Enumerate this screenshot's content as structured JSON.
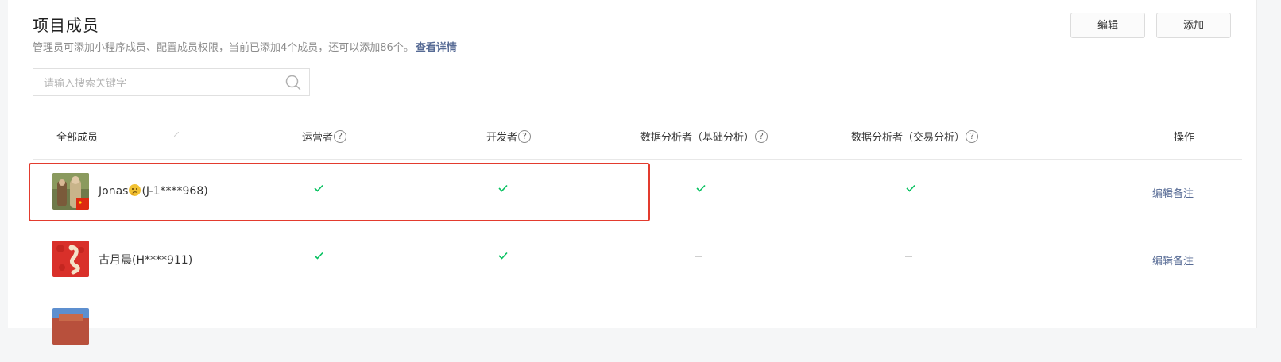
{
  "header": {
    "title": "项目成员",
    "subtitle": "管理员可添加小程序成员、配置成员权限，当前已添加4个成员，还可以添加86个。",
    "detail_link": "查看详情"
  },
  "toolbar": {
    "edit_label": "编辑",
    "add_label": "添加"
  },
  "search": {
    "placeholder": "请输入搜索关键字",
    "value": ""
  },
  "table": {
    "columns": {
      "all_members": "全部成员",
      "operator": "运营者",
      "developer": "开发者",
      "analyst_basic": "数据分析者（基础分析）",
      "analyst_trade": "数据分析者（交易分析）",
      "actions": "操作"
    },
    "rows": [
      {
        "name_prefix": "Jonas",
        "name_suffix": "(J-1****968)",
        "operator": true,
        "developer": true,
        "analyst_basic": true,
        "analyst_trade": true,
        "action": "编辑备注",
        "highlighted": true
      },
      {
        "name": "古月晨(H****911)",
        "operator": true,
        "developer": true,
        "analyst_basic": false,
        "analyst_trade": false,
        "action": "编辑备注",
        "highlighted": false
      }
    ]
  },
  "colors": {
    "link": "#576b95",
    "check": "#07c160",
    "highlight_border": "#e33b2e"
  },
  "icons": {
    "search": "search-icon",
    "help": "question-circle-icon",
    "check": "check-icon",
    "emoji": "thinking-face-emoji"
  }
}
